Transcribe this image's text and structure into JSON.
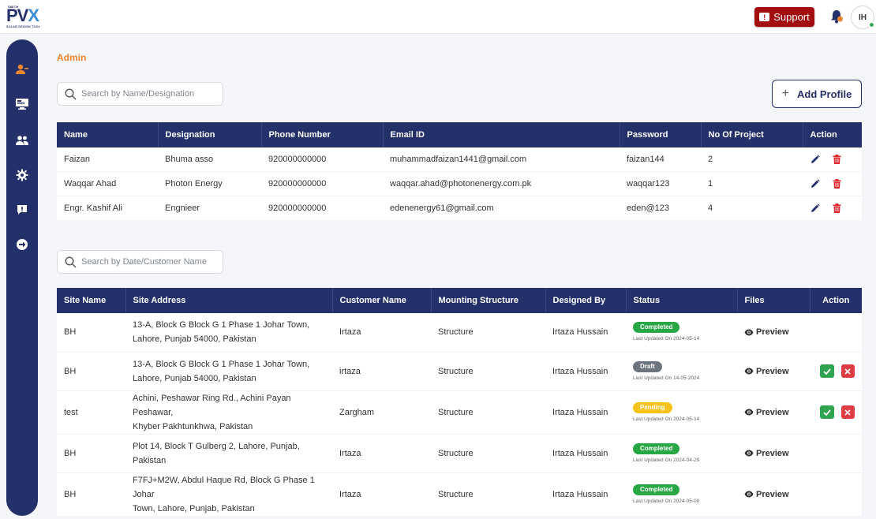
{
  "header": {
    "logo": {
      "top_text": "SMITH",
      "main_text": "PV",
      "accent_text": "X",
      "sub_text": "SOLAR DESIGN TOOL"
    },
    "support_label": "Support",
    "avatar_initials": "IH",
    "colors": {
      "navy": "#243069",
      "support": "#a40d10",
      "accent": "#f0852b"
    }
  },
  "sidebar": {
    "icons": [
      "user-admin-icon",
      "monitor-icon",
      "users-icon",
      "gear-icon",
      "feedback-icon",
      "logout-icon"
    ]
  },
  "page": {
    "title": "Admin"
  },
  "profiles": {
    "search_placeholder": "Search by Name/Designation",
    "add_label": "Add Profile",
    "columns": [
      "Name",
      "Designation",
      "Phone Number",
      "Email ID",
      "Password",
      "No Of Project",
      "Action"
    ],
    "rows": [
      {
        "name": "Faizan",
        "designation": "Bhuma asso",
        "phone": "920000000000",
        "email": "muhammadfaizan1441@gmail.com",
        "password": "faizan144",
        "projects": "2"
      },
      {
        "name": "Waqqar Ahad",
        "designation": "Photon Energy",
        "phone": "920000000000",
        "email": "waqqar.ahad@photonenergy.com.pk",
        "password": "waqqar123",
        "projects": "1"
      },
      {
        "name": "Engr. Kashif Ali",
        "designation": "Engnieer",
        "phone": "920000000000",
        "email": "edenenergy61@gmail.com",
        "password": "eden@123",
        "projects": "4"
      }
    ]
  },
  "sites": {
    "search_placeholder": "Search by Date/Customer Name",
    "columns": [
      "Site Name",
      "Site Address",
      "Customer Name",
      "Mounting Structure",
      "Designed By",
      "Status",
      "Files",
      "Action"
    ],
    "preview_label": "Preview",
    "rows": [
      {
        "site": "BH",
        "address_1": "13-A, Block G Block G 1 Phase 1 Johar Town,",
        "address_2": "Lahore, Punjab 54000, Pakistan",
        "customer": "Irtaza",
        "mounting": "Structure",
        "designer": "Irtaza Hussain",
        "status": "Completed",
        "updated": "Last Updated On 2024-05-14"
      },
      {
        "site": "BH",
        "address_1": "13-A, Block G Block G 1 Phase 1 Johar Town,",
        "address_2": "Lahore, Punjab 54000, Pakistan",
        "customer": "irtaza",
        "mounting": "Structure",
        "designer": "Irtaza Hussain",
        "status": "Draft",
        "updated": "Last Updated On 14-05-2024"
      },
      {
        "site": "test",
        "address_1": "Achini, Peshawar Ring Rd., Achini Payan Peshawar,",
        "address_2": "Khyber Pakhtunkhwa, Pakistan",
        "customer": "Zargham",
        "mounting": "Structure",
        "designer": "Irtaza Hussain",
        "status": "Pending",
        "updated": "Last Updated On 2024-05-14"
      },
      {
        "site": "BH",
        "address_1": "Plot 14, Block T Gulberg 2, Lahore, Punjab,",
        "address_2": "Pakistan",
        "customer": "Irtaza",
        "mounting": "Structure",
        "designer": "Irtaza Hussain",
        "status": "Completed",
        "updated": "Last Updated On 2024-04-29"
      },
      {
        "site": "BH",
        "address_1": "F7FJ+M2W, Abdul Haque Rd, Block G Phase 1 Johar",
        "address_2": "Town, Lahore, Punjab, Pakistan",
        "customer": "Irtaza",
        "mounting": "Structure",
        "designer": "Irtaza Hussain",
        "status": "Completed",
        "updated": "Last Updated On 2024-05-08"
      }
    ]
  }
}
